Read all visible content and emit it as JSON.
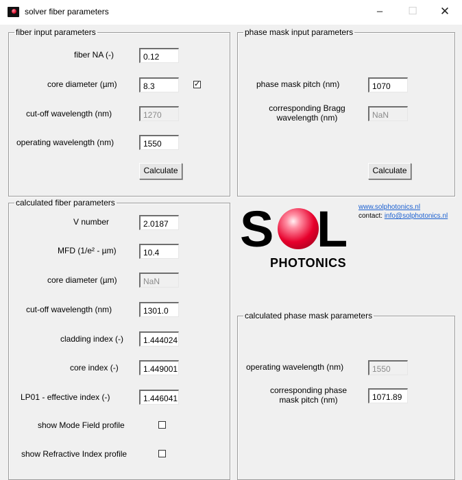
{
  "window": {
    "title": "solver fiber parameters",
    "minimize_glyph": "–",
    "maximize_glyph": "☐",
    "close_glyph": "✕"
  },
  "fiber_input": {
    "legend": "fiber input parameters",
    "fiber_na_label": "fiber NA (-)",
    "fiber_na_value": "0.12",
    "core_diameter_label": "core diameter (µm)",
    "core_diameter_value": "8.3",
    "core_diameter_checked": "✓",
    "cutoff_label": "cut-off wavelength (nm)",
    "cutoff_value": "1270",
    "operating_label": "operating wavelength (nm)",
    "operating_value": "1550",
    "calculate_label": "Calculate"
  },
  "phase_mask_input": {
    "legend": "phase mask input parameters",
    "pitch_label": "phase mask pitch (nm)",
    "pitch_value": "1070",
    "bragg_label": "corresponding Bragg wavelength (nm)",
    "bragg_value": "NaN",
    "calculate_label": "Calculate"
  },
  "calculated_fiber": {
    "legend": "calculated fiber parameters",
    "v_number_label": "V number",
    "v_number_value": "2.0187",
    "mfd_label": "MFD (1/e² - µm)",
    "mfd_value": "10.4",
    "core_diameter_label": "core diameter (µm)",
    "core_diameter_value": "NaN",
    "cutoff_label": "cut-off wavelength (nm)",
    "cutoff_value": "1301.0",
    "cladding_label": "cladding index (-)",
    "cladding_value": "1.444024",
    "core_index_label": "core index (-)",
    "core_index_value": "1.449001",
    "lp01_label": "LP01 - effective index (-)",
    "lp01_value": "1.446041",
    "mode_field_label": "show Mode Field profile",
    "refractive_label": "show Refractive Index profile"
  },
  "calculated_phase_mask": {
    "legend": "calculated phase mask parameters",
    "operating_label": "operating wavelength (nm)",
    "operating_value": "1550",
    "pitch_label": "corresponding phase mask pitch (nm)",
    "pitch_value": "1071.89"
  },
  "branding": {
    "logo_s": "S",
    "logo_l": "L",
    "logo_photonics": "PHOTONICS",
    "website": "www.solphotonics.nl",
    "contact_prefix": "contact: ",
    "contact_email": "info@solphotonics.nl",
    "accent_color": "#e7002c",
    "link_color": "#1a5fd0"
  }
}
